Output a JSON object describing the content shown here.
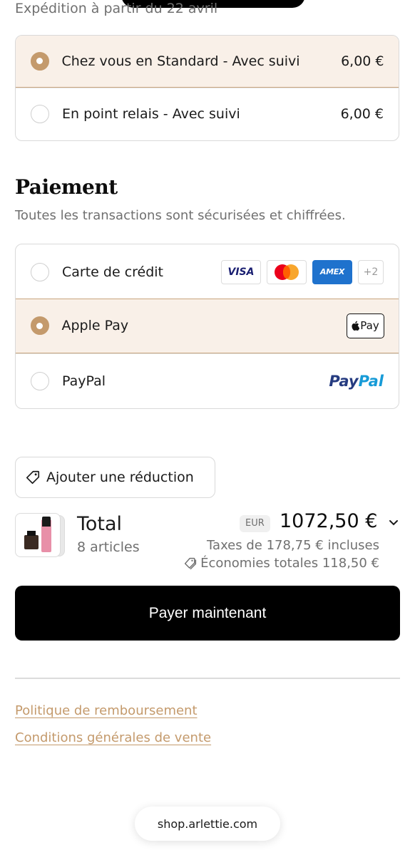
{
  "shipping": {
    "note": "Expédition à partir du 22 avril",
    "options": [
      {
        "label": "Chez vous en Standard - Avec suivi",
        "price": "6,00 €",
        "selected": true
      },
      {
        "label": "En point relais - Avec suivi",
        "price": "6,00 €",
        "selected": false
      }
    ]
  },
  "payment": {
    "title": "Paiement",
    "subtitle": "Toutes les transactions sont sécurisées et chiffrées.",
    "options": [
      {
        "label": "Carte de crédit",
        "selected": false
      },
      {
        "label": "Apple Pay",
        "selected": true
      },
      {
        "label": "PayPal",
        "selected": false
      }
    ],
    "card_brands": {
      "visa": "VISA",
      "amex": "AMEX",
      "more": "+2"
    },
    "applepay_badge": "Pay",
    "paypal_logo": {
      "part1": "Pay",
      "part2": "Pal"
    }
  },
  "discount": {
    "label": "Ajouter une réduction"
  },
  "summary": {
    "total_label": "Total",
    "items_count": "8 articles",
    "currency": "EUR",
    "amount": "1072,50 €",
    "taxes": "Taxes de 178,75 € incluses",
    "savings": "Économies totales 118,50 €"
  },
  "pay_button": "Payer maintenant",
  "policies": {
    "refund": "Politique de remboursement",
    "terms": "Conditions générales de vente"
  },
  "browser": {
    "url": "shop.arlettie.com"
  },
  "colors": {
    "accent": "#c49a6c",
    "selected_bg": "#f9f0e8",
    "button": "#000000"
  }
}
